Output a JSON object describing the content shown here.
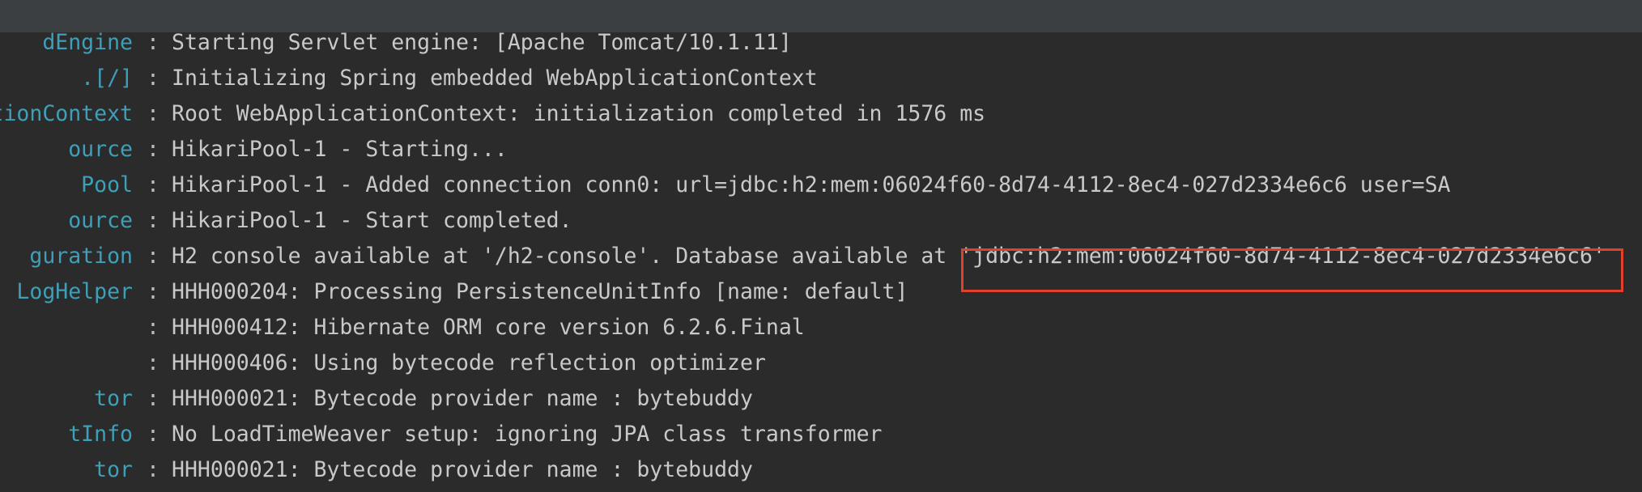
{
  "console": {
    "lines": [
      {
        "logger": "dEngine",
        "separator": ":",
        "message": "Starting Servlet engine: [Apache Tomcat/10.1.11]"
      },
      {
        "logger": ".[/]",
        "separator": ":",
        "message": "Initializing Spring embedded WebApplicationContext"
      },
      {
        "logger": "tionContext",
        "separator": ":",
        "message": "Root WebApplicationContext: initialization completed in 1576 ms"
      },
      {
        "logger": "ource",
        "separator": ":",
        "message": "HikariPool-1 - Starting..."
      },
      {
        "logger": "Pool",
        "separator": ":",
        "message": "HikariPool-1 - Added connection conn0: url=jdbc:h2:mem:06024f60-8d74-4112-8ec4-027d2334e6c6 user=SA"
      },
      {
        "logger": "ource",
        "separator": ":",
        "message": "HikariPool-1 - Start completed."
      },
      {
        "logger": "guration",
        "separator": ":",
        "message": "H2 console available at '/h2-console'. Database available at 'jdbc:h2:mem:06024f60-8d74-4112-8ec4-027d2334e6c6'"
      },
      {
        "logger": "LogHelper",
        "separator": ":",
        "message": "HHH000204: Processing PersistenceUnitInfo [name: default]"
      },
      {
        "logger": "",
        "separator": ":",
        "message": "HHH000412: Hibernate ORM core version 6.2.6.Final"
      },
      {
        "logger": "",
        "separator": ":",
        "message": "HHH000406: Using bytecode reflection optimizer"
      },
      {
        "logger": "tor",
        "separator": ":",
        "message": "HHH000021: Bytecode provider name : bytebuddy"
      },
      {
        "logger": "tInfo",
        "separator": ":",
        "message": "No LoadTimeWeaver setup: ignoring JPA class transformer"
      },
      {
        "logger": "tor",
        "separator": ":",
        "message": "HHH000021: Bytecode provider name : bytebuddy"
      }
    ],
    "highlighted_text": "'jdbc:h2:mem:06024f60-8d74-4112-8ec4-027d2334e6c6'"
  },
  "colors": {
    "background": "#2b2b2b",
    "topbar": "#3c3f41",
    "logger_text": "#3e9fb8",
    "message_text": "#c9c9c9",
    "highlight_border": "#e0412f"
  }
}
